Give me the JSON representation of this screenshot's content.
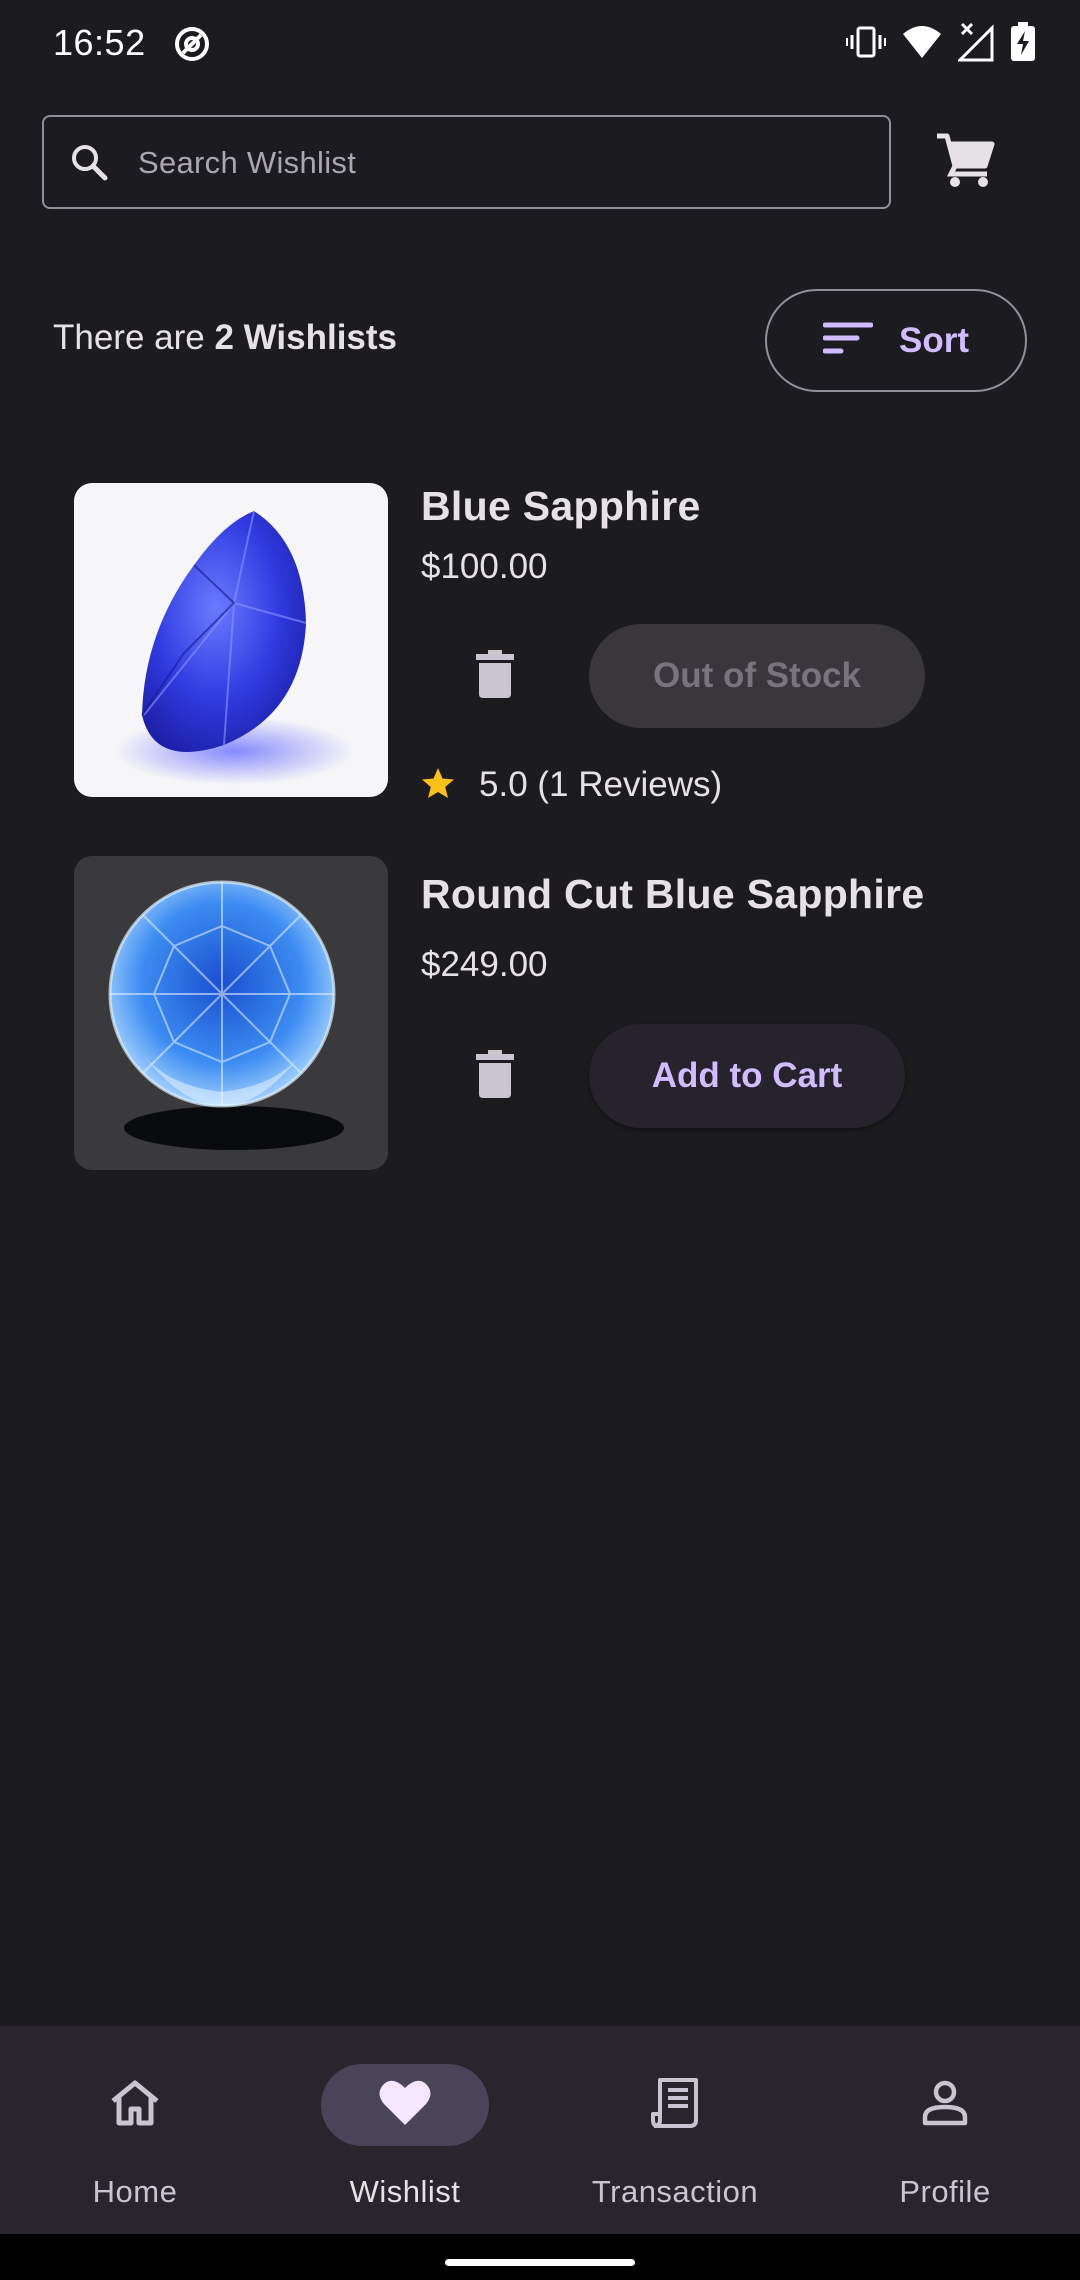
{
  "status_bar": {
    "time": "16:52",
    "icons": [
      "at-sign-icon",
      "vibrate-icon",
      "wifi-icon",
      "signal-icon",
      "battery-charging-icon"
    ]
  },
  "search": {
    "placeholder": "Search Wishlist",
    "icon": "search-icon"
  },
  "header": {
    "cart_icon": "cart-icon",
    "count_prefix": "There are",
    "count_bold": "2 Wishlists",
    "sort_label": "Sort",
    "sort_icon": "sort-icon"
  },
  "products": [
    {
      "name": "Blue Sapphire",
      "price": "$100.00",
      "button_label": "Out of Stock",
      "button_enabled": false,
      "rating_text": "5.0 (1 Reviews)"
    },
    {
      "name": "Round Cut Blue Sapphire",
      "price": "$249.00",
      "button_label": "Add to Cart",
      "button_enabled": true
    }
  ],
  "bottom_nav": {
    "items": [
      {
        "label": "Home",
        "icon": "home-icon",
        "active": false
      },
      {
        "label": "Wishlist",
        "icon": "heart-icon",
        "active": true
      },
      {
        "label": "Transaction",
        "icon": "receipt-icon",
        "active": false
      },
      {
        "label": "Profile",
        "icon": "person-icon",
        "active": false
      }
    ]
  },
  "colors": {
    "background": "#1c1b1f",
    "accent": "#d0bcff",
    "nav_background": "#28252d",
    "star": "#f9c11a"
  }
}
